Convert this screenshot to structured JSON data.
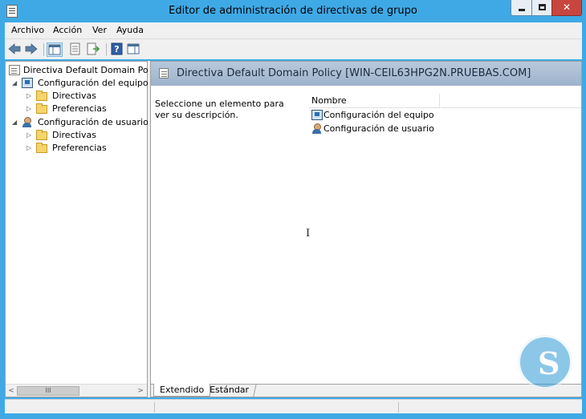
{
  "window": {
    "title": "Editor de administración de directivas de grupo",
    "controls": {
      "minimize": "▬",
      "maximize": "□",
      "close": "✕"
    }
  },
  "menu": [
    "Archivo",
    "Acción",
    "Ver",
    "Ayuda"
  ],
  "toolbar": {
    "buttons": [
      "back-icon",
      "forward-icon",
      "show-hide-tree-icon",
      "properties-icon",
      "export-list-icon",
      "help-icon",
      "action-pane-icon"
    ]
  },
  "tree": {
    "root": "Directiva Default Domain Policy",
    "computer": "Configuración del equipo",
    "computer_children": [
      "Directivas",
      "Preferencias"
    ],
    "user": "Configuración de usuario",
    "user_children": [
      "Directivas",
      "Preferencias"
    ],
    "expanded_glyph": "◢",
    "collapsed_glyph": "▷"
  },
  "details": {
    "header": "Directiva Default Domain Policy [WIN-CEIL63HPG2N.PRUEBAS.COM]",
    "description": "Seleccione un elemento para ver su descripción.",
    "column": "Nombre",
    "items": [
      "Configuración del equipo",
      "Configuración de usuario"
    ]
  },
  "tabs": [
    "Extendido",
    "Estándar"
  ],
  "scrollbar": {
    "left_arrow": "<",
    "right_arrow": ">",
    "thumb": "III"
  },
  "colors": {
    "titlebar": "#3fa9e6",
    "header": "#9db2cb",
    "close": "#c7463f"
  }
}
